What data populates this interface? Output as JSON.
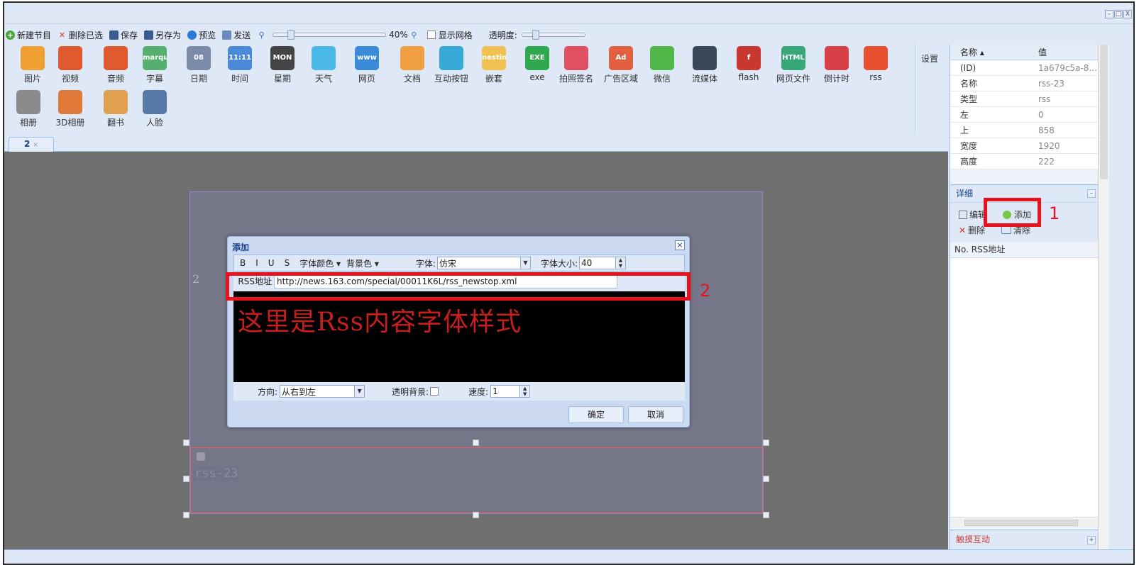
{
  "window": {
    "min": "–",
    "max": "□",
    "close": "X"
  },
  "toolbar": {
    "new_program": "新建节目",
    "delete_selected": "删除已选",
    "save": "保存",
    "save_as": "另存为",
    "preview": "预览",
    "send": "发送",
    "zoom": "40%",
    "show_grid": "显示网格",
    "opacity": "透明度:"
  },
  "palette": {
    "items": [
      {
        "label": "图片",
        "icon": "image-icon",
        "color": "#f0a030"
      },
      {
        "label": "视频",
        "icon": "video-icon",
        "color": "#e05a30"
      },
      {
        "label": "音频",
        "icon": "audio-icon",
        "color": "#e05a30"
      },
      {
        "label": "字幕",
        "icon": "marquee-icon",
        "color": "#55b070",
        "text": "marquee"
      },
      {
        "label": "日期",
        "icon": "date-icon",
        "color": "#7a8aa8",
        "text": "08"
      },
      {
        "label": "时间",
        "icon": "time-icon",
        "color": "#4a8ad8",
        "text": "11:11"
      },
      {
        "label": "星期",
        "icon": "week-icon",
        "color": "#444444",
        "text": "MON"
      },
      {
        "label": "天气",
        "icon": "weather-icon",
        "color": "#4ab8e8"
      },
      {
        "label": "网页",
        "icon": "webpage-icon",
        "color": "#3a8ad8",
        "text": "www"
      },
      {
        "label": "文档",
        "icon": "document-icon",
        "color": "#f0a040"
      },
      {
        "label": "互动按钮",
        "icon": "interactive-button-icon",
        "color": "#38a8d8"
      },
      {
        "label": "嵌套",
        "icon": "nesting-icon",
        "color": "#f0c050",
        "text": "nesting"
      },
      {
        "label": "exe",
        "icon": "exe-icon",
        "color": "#30a850",
        "text": "EXE"
      },
      {
        "label": "拍照签名",
        "icon": "photo-sign-icon",
        "color": "#e05060"
      },
      {
        "label": "广告区域",
        "icon": "ad-area-icon",
        "color": "#e06040",
        "text": "Ad"
      },
      {
        "label": "微信",
        "icon": "wechat-icon",
        "color": "#50b848"
      },
      {
        "label": "流媒体",
        "icon": "stream-icon",
        "color": "#384858"
      },
      {
        "label": "flash",
        "icon": "flash-icon",
        "color": "#c83830",
        "text": "f"
      },
      {
        "label": "网页文件",
        "icon": "html-file-icon",
        "color": "#38a878",
        "text": "HTML"
      },
      {
        "label": "倒计时",
        "icon": "countdown-icon",
        "color": "#d84048"
      },
      {
        "label": "rss",
        "icon": "rss-icon",
        "color": "#e85030"
      },
      {
        "label": "相册",
        "icon": "album-icon",
        "color": "#8a8a8a"
      },
      {
        "label": "3D相册",
        "icon": "3d-album-icon",
        "color": "#e07838"
      },
      {
        "label": "翻书",
        "icon": "flipbook-icon",
        "color": "#e0a050"
      },
      {
        "label": "人脸",
        "icon": "face-icon",
        "color": "#5878a8"
      }
    ],
    "settings": "设置"
  },
  "tab": {
    "label": "2",
    "close": "×"
  },
  "stage": {
    "number": "2",
    "rss_label": "rss-23"
  },
  "dialog": {
    "title": "添加",
    "close": "×",
    "fmt": {
      "b": "B",
      "i": "I",
      "u": "U",
      "s": "S",
      "font_color": "字体颜色 ▾",
      "bg_color": "背景色 ▾",
      "font_label": "字体:",
      "font_value": "仿宋",
      "size_label": "字体大小:",
      "size_value": "40"
    },
    "rss_label": "RSS地址",
    "rss_value": "http://news.163.com/special/00011K6L/rss_newstop.xml",
    "preview_text": "这里是Rss内容字体样式",
    "direction_label": "方向:",
    "direction_value": "从右到左",
    "transparent_label": "透明背景:",
    "speed_label": "速度:",
    "speed_value": "1",
    "ok": "确定",
    "cancel": "取消"
  },
  "annotations": {
    "one": "1",
    "two": "2"
  },
  "properties": {
    "header_name": "名称 ▴",
    "header_value": "值",
    "rows": [
      {
        "k": "(ID)",
        "v": "1a679c5a-8..."
      },
      {
        "k": "名称",
        "v": "rss-23"
      },
      {
        "k": "类型",
        "v": "rss"
      },
      {
        "k": "左",
        "v": "0"
      },
      {
        "k": "上",
        "v": "858"
      },
      {
        "k": "宽度",
        "v": "1920"
      },
      {
        "k": "高度",
        "v": "222"
      }
    ]
  },
  "detail": {
    "title": "详细",
    "edit": "编辑",
    "add": "添加",
    "delete": "删除",
    "clear": "清除",
    "col_no": "No.",
    "col_rss": "RSS地址"
  },
  "touch": {
    "label": "触摸互动"
  }
}
